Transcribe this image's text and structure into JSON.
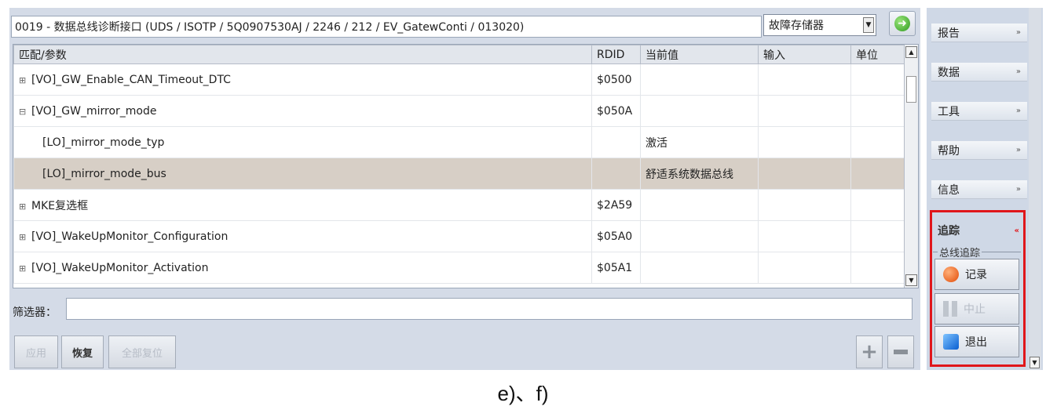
{
  "header": {
    "title": "0019 - 数据总线诊断接口 (UDS / ISOTP / 5Q0907530AJ / 2246 / 212 / EV_GatewConti / 013020)",
    "dropdown_value": "故障存储器",
    "go_icon": "arrow-right-icon"
  },
  "table": {
    "columns": [
      "匹配/参数",
      "RDID",
      "当前值",
      "输入",
      "单位"
    ],
    "rows": [
      {
        "expander": "⊞",
        "name": "[VO]_GW_Enable_CAN_Timeout_DTC",
        "rdid": "$0500",
        "value": "",
        "input": "",
        "unit": ""
      },
      {
        "expander": "⊟",
        "name": "[VO]_GW_mirror_mode",
        "rdid": "$050A",
        "value": "",
        "input": "",
        "unit": ""
      },
      {
        "expander": "",
        "name": "[LO]_mirror_mode_typ",
        "rdid": "",
        "value": "激活",
        "input": "",
        "unit": ""
      },
      {
        "expander": "",
        "name": "[LO]_mirror_mode_bus",
        "rdid": "",
        "value": "舒适系统数据总线",
        "input": "",
        "unit": ""
      },
      {
        "expander": "⊞",
        "name": "MKE复选框",
        "rdid": "$2A59",
        "value": "",
        "input": "",
        "unit": ""
      },
      {
        "expander": "⊞",
        "name": "[VO]_WakeUpMonitor_Configuration",
        "rdid": "$05A0",
        "value": "",
        "input": "",
        "unit": ""
      },
      {
        "expander": "⊞",
        "name": "[VO]_WakeUpMonitor_Activation",
        "rdid": "$05A1",
        "value": "",
        "input": "",
        "unit": ""
      }
    ]
  },
  "filter": {
    "label": "筛选器：",
    "value": ""
  },
  "buttons": {
    "apply": "应用",
    "restore": "恢复",
    "reset_all": "全部复位"
  },
  "sidebar": {
    "items": [
      "报告",
      "数据",
      "工具",
      "帮助",
      "信息"
    ],
    "trace": {
      "title": "追踪",
      "group": "总线追踪",
      "record": "记录",
      "stop": "中止",
      "exit": "退出"
    }
  },
  "caption": "e)、f)"
}
